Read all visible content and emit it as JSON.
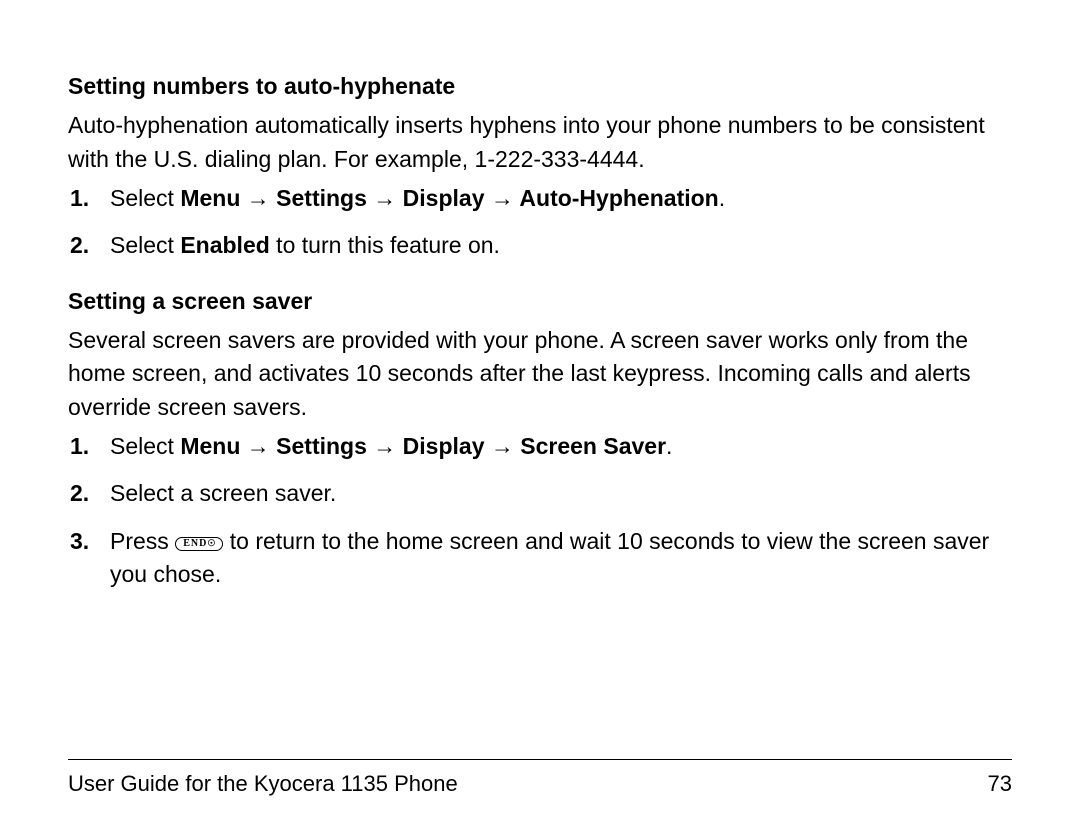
{
  "section1": {
    "heading": "Setting numbers to auto-hyphenate",
    "para": "Auto-hyphenation automatically inserts hyphens into your phone numbers to be consistent with the U.S. dialing plan. For example, 1-222-333-4444.",
    "step1_pre": "Select ",
    "step1_path": "Menu → Settings → Display → Auto-Hyphenation",
    "step1_post": ".",
    "step2_pre": "Select ",
    "step2_bold": "Enabled",
    "step2_post": " to turn this feature on."
  },
  "section2": {
    "heading": "Setting a screen saver",
    "para": "Several screen savers are provided with your phone. A screen saver works only from the home screen, and activates 10 seconds after the last keypress. Incoming calls and alerts override screen savers.",
    "step1_pre": "Select ",
    "step1_path": "Menu → Settings → Display → Screen Saver",
    "step1_post": ".",
    "step2": "Select a screen saver.",
    "step3_pre": "Press ",
    "step3_key": "END",
    "step3_keysym": "☉",
    "step3_post": " to return to the home screen and wait 10 seconds to view the screen saver you chose."
  },
  "footer": {
    "left": "User Guide for the Kyocera 1135 Phone",
    "right": "73"
  }
}
